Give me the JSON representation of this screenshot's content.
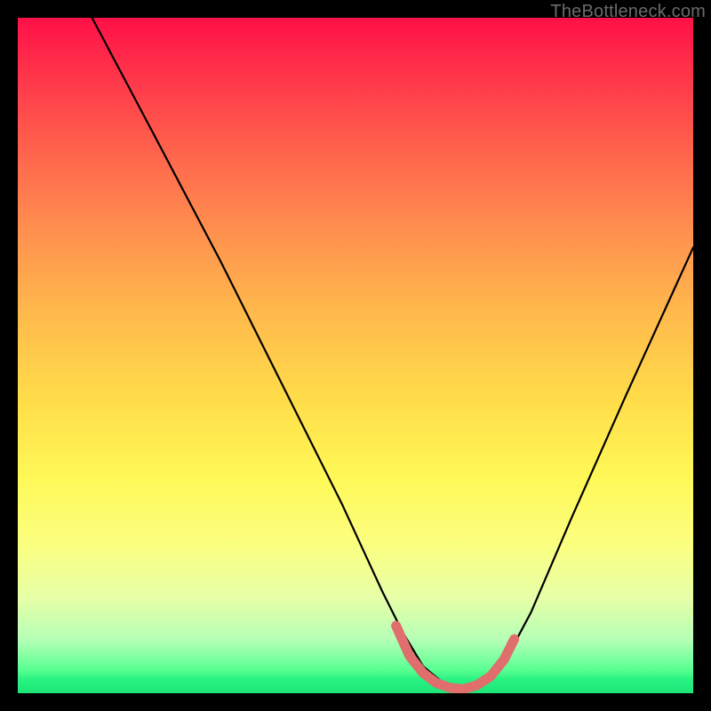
{
  "watermark": "TheBottleneck.com",
  "chart_data": {
    "type": "line",
    "title": "",
    "xlabel": "",
    "ylabel": "",
    "xlim": [
      0,
      100
    ],
    "ylim": [
      0,
      100
    ],
    "series": [
      {
        "name": "curve",
        "color": "#000000",
        "x": [
          11,
          20,
          30,
          40,
          48,
          54,
          57,
          60,
          63,
          66,
          69,
          72,
          76,
          82,
          90,
          100
        ],
        "y": [
          100,
          83,
          64,
          44,
          28,
          15,
          9,
          4,
          1.5,
          0.7,
          1.5,
          4.5,
          12,
          26,
          44,
          66
        ]
      }
    ],
    "highlight_segment": {
      "name": "low-region",
      "color": "#e07070",
      "x": [
        56,
        58,
        60,
        62,
        64,
        66,
        68,
        70,
        72,
        73.5
      ],
      "y": [
        10,
        5.5,
        3,
        1.5,
        0.8,
        0.6,
        1.2,
        2.5,
        5,
        8
      ]
    },
    "background_gradient": {
      "top": "#ff1048",
      "mid": "#ffde4a",
      "bottom": "#1be678"
    }
  }
}
